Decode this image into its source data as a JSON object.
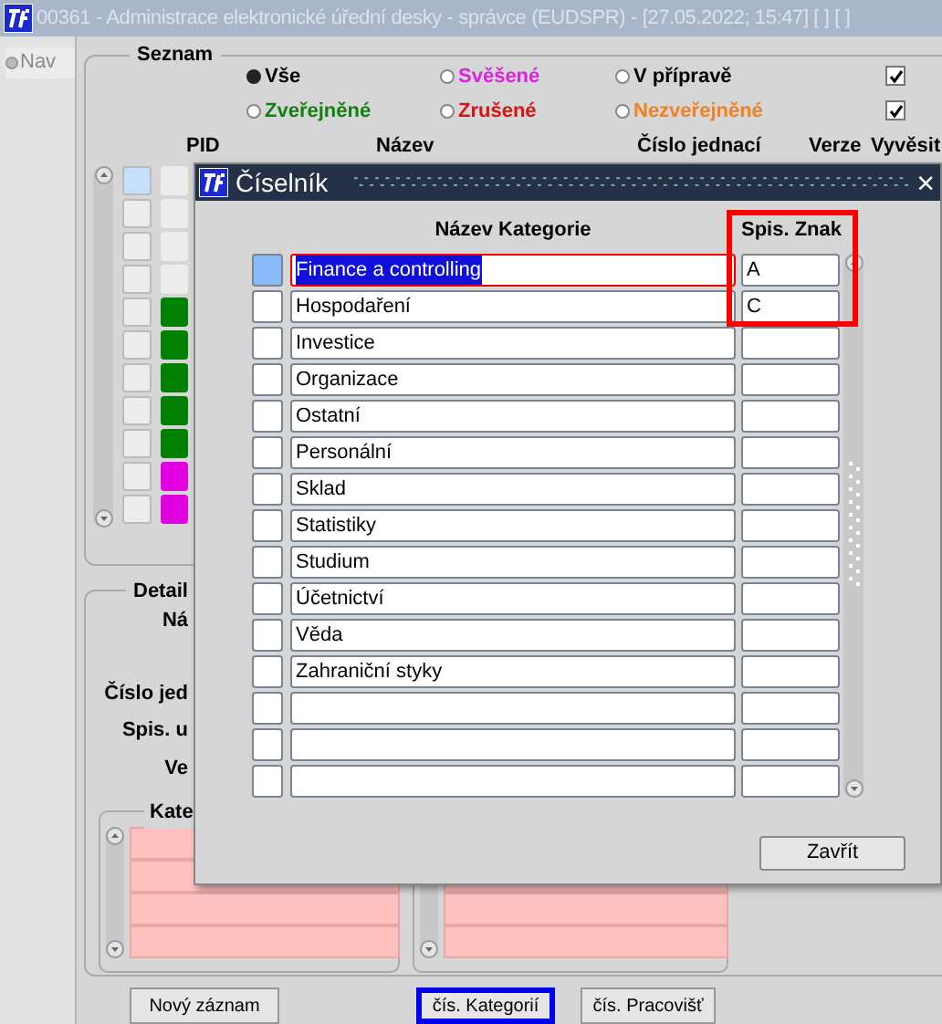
{
  "window": {
    "title": "00361 - Administrace elektronické úřední desky - správce (EUDSPR) - [27.05.2022; 15:47]  [ ]  [ ]"
  },
  "nav": {
    "label": "Nav",
    "selected": true
  },
  "seznam": {
    "title": "Seznam",
    "filters": [
      {
        "label": "Vše",
        "selected": true,
        "color": "#000000"
      },
      {
        "label": "Svěšené",
        "selected": false,
        "color": "#e020e0"
      },
      {
        "label": "V přípravě",
        "selected": false,
        "color": "#000000"
      },
      {
        "label": "Zveřejněné",
        "selected": false,
        "color": "#108010"
      },
      {
        "label": "Zrušené",
        "selected": false,
        "color": "#e01010"
      },
      {
        "label": "Nezveřejněné",
        "selected": false,
        "color": "#f08020"
      }
    ],
    "checkboxes": [
      {
        "checked": true
      },
      {
        "checked": true
      }
    ],
    "columns": [
      "PID",
      "Název",
      "Číslo jednací",
      "Verze",
      "Vyvěsit"
    ],
    "rows": [
      {
        "selected": true,
        "color": "#ececec"
      },
      {
        "selected": false,
        "color": "#ececec"
      },
      {
        "selected": false,
        "color": "#ececec"
      },
      {
        "selected": false,
        "color": "#ececec"
      },
      {
        "selected": false,
        "color": "#008000"
      },
      {
        "selected": false,
        "color": "#008000"
      },
      {
        "selected": false,
        "color": "#008000"
      },
      {
        "selected": false,
        "color": "#008000"
      },
      {
        "selected": false,
        "color": "#008000"
      },
      {
        "selected": false,
        "color": "#e000e0"
      },
      {
        "selected": false,
        "color": "#e000e0"
      }
    ]
  },
  "detail": {
    "title": "Detail",
    "labels": [
      "Ná",
      "Číslo jed",
      "Spis. u",
      "Ve"
    ],
    "kategorie_title": "Kate"
  },
  "buttons": [
    {
      "label": "Nový záznam",
      "focused": false
    },
    {
      "label": "čís. Kategorií",
      "focused": true
    },
    {
      "label": "čís. Pracovišť",
      "focused": false
    }
  ],
  "dialog": {
    "title": "Číselník",
    "close": "×",
    "columns": [
      "Název Kategorie",
      "Spis. Znak"
    ],
    "rows": [
      {
        "name": "Finance a controlling",
        "code": "A",
        "selected": true
      },
      {
        "name": "Hospodaření",
        "code": "C",
        "selected": false
      },
      {
        "name": "Investice",
        "selected": false
      },
      {
        "name": "Organizace",
        "selected": false
      },
      {
        "name": "Ostatní",
        "selected": false
      },
      {
        "name": "Personální",
        "selected": false
      },
      {
        "name": "Sklad",
        "selected": false
      },
      {
        "name": "Statistiky",
        "selected": false
      },
      {
        "name": "Studium",
        "selected": false
      },
      {
        "name": "Účetnictví",
        "selected": false
      },
      {
        "name": "Věda",
        "selected": false
      },
      {
        "name": "Zahraniční styky",
        "selected": false
      },
      {
        "selected": false
      },
      {
        "selected": false
      },
      {
        "selected": false
      }
    ],
    "close_button": "Zavřít"
  }
}
